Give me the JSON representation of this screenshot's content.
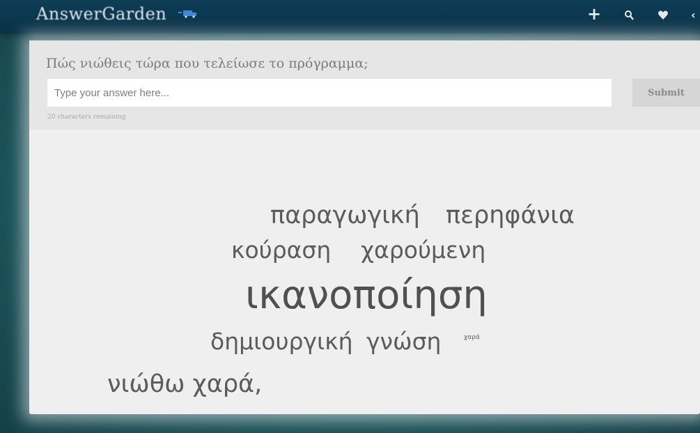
{
  "app": {
    "logo_text": "AnswerGarden",
    "logo_icon": "truck-icon"
  },
  "nav": {
    "icons": [
      "plus-icon",
      "search-icon",
      "heart-icon",
      "share-icon"
    ],
    "glyphs": [
      "+",
      "⚲",
      "♥",
      "‹"
    ]
  },
  "question": {
    "text": "Πώς νιώθεις τώρα που τελείωσε το πρόγραμμα;",
    "input_placeholder": "Type your answer here...",
    "input_value": "",
    "submit_label": "Submit",
    "remaining_text": "20 characters remaining"
  },
  "word_cloud": {
    "words": [
      {
        "text": "παραγωγική",
        "weight": 2
      },
      {
        "text": "περηφάνια",
        "weight": 2
      },
      {
        "text": "κούραση",
        "weight": 2
      },
      {
        "text": "χαρούμενη",
        "weight": 2
      },
      {
        "text": "ικανοποίηση",
        "weight": 4
      },
      {
        "text": "δημιουργική",
        "weight": 2
      },
      {
        "text": "γνώση",
        "weight": 2
      },
      {
        "text": "χαρά",
        "weight": 1
      },
      {
        "text": "νιώθω χαρά,",
        "weight": 2
      }
    ]
  },
  "colors": {
    "topbar": "#0e3d56",
    "background": "#1f5860",
    "panel": "#efefef",
    "word": "#5b5b5b"
  }
}
